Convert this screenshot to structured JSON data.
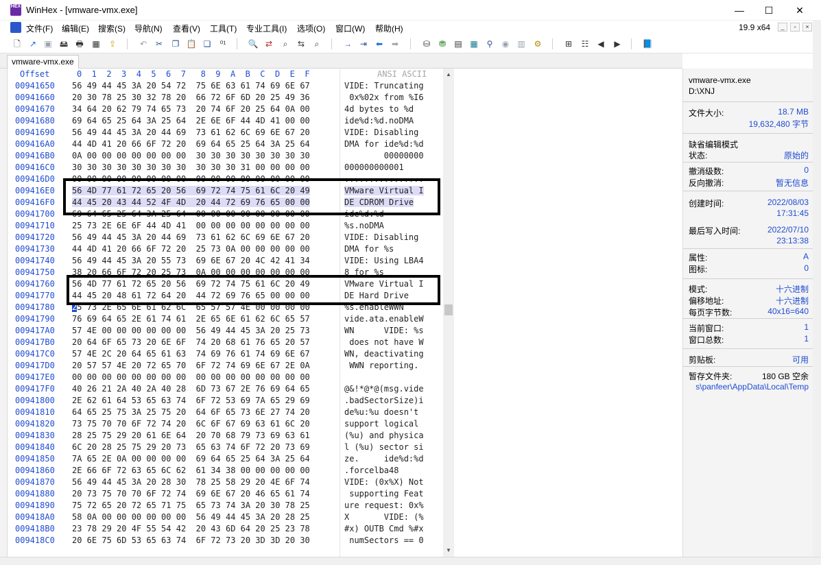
{
  "window": {
    "title": "WinHex - [vmware-vmx.exe]",
    "app_logo_text": "HEX",
    "minimize": "—",
    "maximize": "☐",
    "close": "✕"
  },
  "menu": {
    "items": [
      "文件(F)",
      "编辑(E)",
      "搜索(S)",
      "导航(N)",
      "查看(V)",
      "工具(T)",
      "专业工具(I)",
      "选项(O)",
      "窗口(W)",
      "帮助(H)"
    ],
    "zoom": "19.9 x64",
    "mdi_min": "_",
    "mdi_restore": "▫",
    "mdi_close": "×"
  },
  "toolbar": {
    "icons": [
      {
        "name": "new-file-icon",
        "glyph": "🗋"
      },
      {
        "name": "open-file-icon",
        "glyph": "↗"
      },
      {
        "name": "save-icon",
        "glyph": "▣"
      },
      {
        "name": "save-all-icon",
        "glyph": "🖴"
      },
      {
        "name": "print-icon",
        "glyph": "🖶"
      },
      {
        "name": "properties-icon",
        "glyph": "▦"
      },
      {
        "name": "export-icon",
        "glyph": "⇪"
      },
      {
        "name": "undo-icon",
        "glyph": "↶"
      },
      {
        "name": "cut-icon",
        "glyph": "✂"
      },
      {
        "name": "copy-icon",
        "glyph": "❐"
      },
      {
        "name": "paste-icon",
        "glyph": "📋"
      },
      {
        "name": "paste-write-icon",
        "glyph": "❏"
      },
      {
        "name": "convert-icon",
        "glyph": "⁰¹"
      },
      {
        "name": "find-text-icon",
        "glyph": "🔍"
      },
      {
        "name": "replace-text-icon",
        "glyph": "⇄"
      },
      {
        "name": "find-hex-icon",
        "glyph": "⌕"
      },
      {
        "name": "replace-hex-icon",
        "glyph": "⇆"
      },
      {
        "name": "goto-offset-icon",
        "glyph": "→"
      },
      {
        "name": "goto-sector-icon",
        "glyph": "⇥"
      },
      {
        "name": "back-icon",
        "glyph": "⬅"
      },
      {
        "name": "forward-icon",
        "glyph": "➡"
      },
      {
        "name": "disk-open-icon",
        "glyph": "⛁"
      },
      {
        "name": "disk-add-icon",
        "glyph": "⛃"
      },
      {
        "name": "disk-image-icon",
        "glyph": "▤"
      },
      {
        "name": "calculator-icon",
        "glyph": "▦"
      },
      {
        "name": "magnifier-icon",
        "glyph": "⚲"
      },
      {
        "name": "dial-icon",
        "glyph": "◉"
      },
      {
        "name": "ram-icon",
        "glyph": "▥"
      },
      {
        "name": "gear-icon",
        "glyph": "⚙"
      },
      {
        "name": "grid-icon",
        "glyph": "⊞"
      },
      {
        "name": "table-icon",
        "glyph": "☷"
      },
      {
        "name": "left-arrow-icon",
        "glyph": "◀"
      },
      {
        "name": "right-arrow-icon",
        "glyph": "▶"
      },
      {
        "name": "book-icon",
        "glyph": "📘"
      }
    ]
  },
  "tab": {
    "label": "vmware-vmx.exe"
  },
  "editor": {
    "header_offset": "Offset",
    "header_hex": "0  1  2  3  4  5  6  7   8  9  A  B  C  D  E  F",
    "header_ansi": "ANSI ASCII",
    "rows": [
      {
        "off": "00941650",
        "hex": "56 49 44 45 3A 20 54 72  75 6E 63 61 74 69 6E 67",
        "asc": "VIDE: Truncating"
      },
      {
        "off": "00941660",
        "hex": "20 30 78 25 30 32 78 20  66 72 6F 6D 20 25 49 36",
        "asc": " 0x%02x from %I6"
      },
      {
        "off": "00941670",
        "hex": "34 64 20 62 79 74 65 73  20 74 6F 20 25 64 0A 00",
        "asc": "4d bytes to %d"
      },
      {
        "off": "00941680",
        "hex": "69 64 65 25 64 3A 25 64  2E 6E 6F 44 4D 41 00 00",
        "asc": "ide%d:%d.noDMA"
      },
      {
        "off": "00941690",
        "hex": "56 49 44 45 3A 20 44 69  73 61 62 6C 69 6E 67 20",
        "asc": "VIDE: Disabling "
      },
      {
        "off": "009416A0",
        "hex": "44 4D 41 20 66 6F 72 20  69 64 65 25 64 3A 25 64",
        "asc": "DMA for ide%d:%d"
      },
      {
        "off": "009416B0",
        "hex": "0A 00 00 00 00 00 00 00  30 30 30 30 30 30 30 30",
        "asc": "        00000000"
      },
      {
        "off": "009416C0",
        "hex": "30 30 30 30 30 30 30 30  30 30 30 31 00 00 00 00",
        "asc": "000000000001"
      },
      {
        "off": "009416D0",
        "hex": "00 00 00 00 00 00 00 00  00 00 00 00 00 00 00 00",
        "asc": "................"
      },
      {
        "off": "009416E0",
        "hex": "56 4D 77 61 72 65 20 56  69 72 74 75 61 6C 20 49",
        "asc": "VMware Virtual I",
        "sel": true
      },
      {
        "off": "009416F0",
        "hex": "44 45 20 43 44 52 4F 4D  20 44 72 69 76 65 00 00",
        "asc": "DE CDROM Drive",
        "sel": true
      },
      {
        "off": "00941700",
        "hex": "69 64 65 25 64 3A 25 64  00 00 00 00 00 00 00 00",
        "asc": "ide%d:%d"
      },
      {
        "off": "00941710",
        "hex": "25 73 2E 6E 6F 44 4D 41  00 00 00 00 00 00 00 00",
        "asc": "%s.noDMA"
      },
      {
        "off": "00941720",
        "hex": "56 49 44 45 3A 20 44 69  73 61 62 6C 69 6E 67 20",
        "asc": "VIDE: Disabling "
      },
      {
        "off": "00941730",
        "hex": "44 4D 41 20 66 6F 72 20  25 73 0A 00 00 00 00 00",
        "asc": "DMA for %s"
      },
      {
        "off": "00941740",
        "hex": "56 49 44 45 3A 20 55 73  69 6E 67 20 4C 42 41 34",
        "asc": "VIDE: Using LBA4"
      },
      {
        "off": "00941750",
        "hex": "38 20 66 6F 72 20 25 73  0A 00 00 00 00 00 00 00",
        "asc": "8 for %s"
      },
      {
        "off": "00941760",
        "hex": "56 4D 77 61 72 65 20 56  69 72 74 75 61 6C 20 49",
        "asc": "VMware Virtual I"
      },
      {
        "off": "00941770",
        "hex": "44 45 20 48 61 72 64 20  44 72 69 76 65 00 00 00",
        "asc": "DE Hard Drive"
      },
      {
        "off": "00941780",
        "hex": "25 73 2E 65 6E 61 62 6C  65 57 57 4E 00 00 00 00",
        "asc": "%s.enableWWN",
        "caret": true
      },
      {
        "off": "00941790",
        "hex": "76 69 64 65 2E 61 74 61  2E 65 6E 61 62 6C 65 57",
        "asc": "vide.ata.enableW"
      },
      {
        "off": "009417A0",
        "hex": "57 4E 00 00 00 00 00 00  56 49 44 45 3A 20 25 73",
        "asc": "WN      VIDE: %s"
      },
      {
        "off": "009417B0",
        "hex": "20 64 6F 65 73 20 6E 6F  74 20 68 61 76 65 20 57",
        "asc": " does not have W"
      },
      {
        "off": "009417C0",
        "hex": "57 4E 2C 20 64 65 61 63  74 69 76 61 74 69 6E 67",
        "asc": "WN, deactivating"
      },
      {
        "off": "009417D0",
        "hex": "20 57 57 4E 20 72 65 70  6F 72 74 69 6E 67 2E 0A",
        "asc": " WWN reporting."
      },
      {
        "off": "009417E0",
        "hex": "00 00 00 00 00 00 00 00  00 00 00 00 00 00 00 00",
        "asc": ""
      },
      {
        "off": "009417F0",
        "hex": "40 26 21 2A 40 2A 40 28  6D 73 67 2E 76 69 64 65",
        "asc": "@&!*@*@(msg.vide"
      },
      {
        "off": "00941800",
        "hex": "2E 62 61 64 53 65 63 74  6F 72 53 69 7A 65 29 69",
        "asc": ".badSectorSize)i"
      },
      {
        "off": "00941810",
        "hex": "64 65 25 75 3A 25 75 20  64 6F 65 73 6E 27 74 20",
        "asc": "de%u:%u doesn't "
      },
      {
        "off": "00941820",
        "hex": "73 75 70 70 6F 72 74 20  6C 6F 67 69 63 61 6C 20",
        "asc": "support logical "
      },
      {
        "off": "00941830",
        "hex": "28 25 75 29 20 61 6E 64  20 70 68 79 73 69 63 61",
        "asc": "(%u) and physica"
      },
      {
        "off": "00941840",
        "hex": "6C 20 28 25 75 29 20 73  65 63 74 6F 72 20 73 69",
        "asc": "l (%u) sector si"
      },
      {
        "off": "00941850",
        "hex": "7A 65 2E 0A 00 00 00 00  69 64 65 25 64 3A 25 64",
        "asc": "ze.     ide%d:%d"
      },
      {
        "off": "00941860",
        "hex": "2E 66 6F 72 63 65 6C 62  61 34 38 00 00 00 00 00",
        "asc": ".forcelba48"
      },
      {
        "off": "00941870",
        "hex": "56 49 44 45 3A 20 28 30  78 25 58 29 20 4E 6F 74",
        "asc": "VIDE: (0x%X) Not"
      },
      {
        "off": "00941880",
        "hex": "20 73 75 70 70 6F 72 74  69 6E 67 20 46 65 61 74",
        "asc": " supporting Feat"
      },
      {
        "off": "00941890",
        "hex": "75 72 65 20 72 65 71 75  65 73 74 3A 20 30 78 25",
        "asc": "ure request: 0x%"
      },
      {
        "off": "009418A0",
        "hex": "58 0A 00 00 00 00 00 00  56 49 44 45 3A 20 28 25",
        "asc": "X       VIDE: (%"
      },
      {
        "off": "009418B0",
        "hex": "23 78 29 20 4F 55 54 42  20 43 6D 64 20 25 23 78",
        "asc": "#x) OUTB Cmd %#x"
      },
      {
        "off": "009418C0",
        "hex": "20 6E 75 6D 53 65 63 74  6F 72 73 20 3D 3D 20 30",
        "asc": " numSectors == 0"
      }
    ]
  },
  "info": {
    "file_name": "vmware-vmx.exe",
    "path": "D:\\XNJ",
    "size_label": "文件大小:",
    "size_mb": "18.7 MB",
    "size_bytes": "19,632,480 字节",
    "edit_mode_label": "缺省编辑模式",
    "state_label": "状态:",
    "state_value": "原始的",
    "undo_level_label": "撤消级数:",
    "undo_level_value": "0",
    "reverse_undo_label": "反向撤消:",
    "reverse_undo_value": "暂无信息",
    "created_label": "创建时间:",
    "created_date": "2022/08/03",
    "created_time": "17:31:45",
    "written_label": "最后写入时间:",
    "written_date": "2022/07/10",
    "written_time": "23:13:38",
    "attr_label": "属性:",
    "attr_value": "A",
    "icon_label": "图标:",
    "icon_value": "0",
    "mode_label": "模式:",
    "mode_value": "十六进制",
    "offset_label": "偏移地址:",
    "offset_value": "十六进制",
    "bpp_label": "每页字节数:",
    "bpp_value": "40x16=640",
    "cur_window_label": "当前窗口:",
    "cur_window_value": "1",
    "total_windows_label": "窗口总数:",
    "total_windows_value": "1",
    "clipboard_label": "剪贴板:",
    "clipboard_value": "可用",
    "temp_label": "暂存文件夹:",
    "temp_free": "180 GB 空余",
    "temp_path": "s\\panfeer\\AppData\\Local\\Temp"
  }
}
